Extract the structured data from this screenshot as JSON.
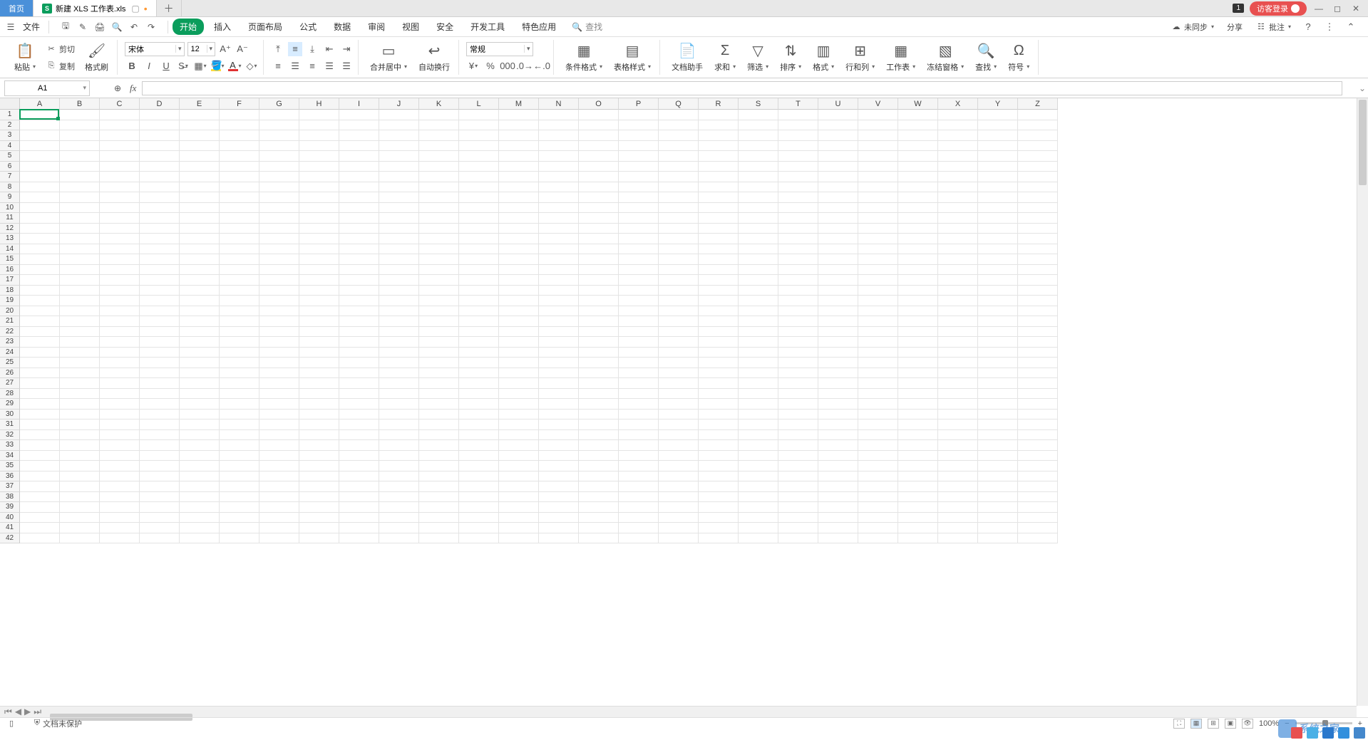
{
  "tabs": {
    "home": "首页",
    "doc_name": "新建 XLS 工作表.xls",
    "doc_icon_letter": "S"
  },
  "titlebar": {
    "notif_count": "1",
    "login": "访客登录"
  },
  "menubar": {
    "file": "文件",
    "ribbon_tabs": [
      "开始",
      "插入",
      "页面布局",
      "公式",
      "数据",
      "审阅",
      "视图",
      "安全",
      "开发工具",
      "特色应用"
    ],
    "search_placeholder": "查找",
    "sync": "未同步",
    "share": "分享",
    "annotate": "批注"
  },
  "ribbon": {
    "paste": "粘贴",
    "cut": "剪切",
    "copy": "复制",
    "format_painter": "格式刷",
    "font_name": "宋体",
    "font_size": "12",
    "merge_center": "合并居中",
    "wrap_text": "自动换行",
    "number_format": "常规",
    "conditional_format": "条件格式",
    "cell_styles": "表格样式",
    "doc_helper": "文档助手",
    "sum": "求和",
    "filter": "筛选",
    "sort": "排序",
    "format": "格式",
    "rows_cols": "行和列",
    "worksheet": "工作表",
    "freeze": "冻结窗格",
    "find": "查找",
    "symbol": "符号"
  },
  "formula": {
    "name_box": "A1",
    "fx": "fx"
  },
  "grid": {
    "columns": [
      "A",
      "B",
      "C",
      "D",
      "E",
      "F",
      "G",
      "H",
      "I",
      "J",
      "K",
      "L",
      "M",
      "N",
      "O",
      "P",
      "Q",
      "R",
      "S",
      "T",
      "U",
      "V",
      "W",
      "X",
      "Y",
      "Z"
    ],
    "rows": 42,
    "active_cell": "A1"
  },
  "status": {
    "doc_protect": "文档未保护",
    "zoom": "100%"
  },
  "watermark": "系统之家"
}
